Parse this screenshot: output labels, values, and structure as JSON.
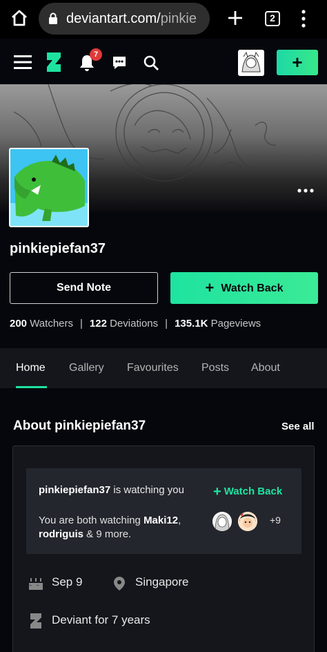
{
  "browser": {
    "url_domain": "deviantart.com/",
    "url_rest": "pinkie",
    "tab_count": "2"
  },
  "header": {
    "notification_count": "7",
    "submit_label": "+"
  },
  "profile": {
    "username": "pinkiepiefan37",
    "send_note_label": "Send Note",
    "watch_back_label": "Watch Back",
    "watch_back_icon": "+",
    "stats": {
      "watchers_count": "200",
      "watchers_label": "Watchers",
      "deviations_count": "122",
      "deviations_label": "Deviations",
      "pageviews_count": "135.1K",
      "pageviews_label": "Pageviews",
      "separator": "|"
    }
  },
  "tabs": [
    {
      "label": "Home",
      "active": true
    },
    {
      "label": "Gallery",
      "active": false
    },
    {
      "label": "Favourites",
      "active": false
    },
    {
      "label": "Posts",
      "active": false
    },
    {
      "label": "About",
      "active": false
    }
  ],
  "about": {
    "title": "About pinkiepiefan37",
    "see_all": "See all",
    "watching_user": "pinkiepiefan37",
    "watching_text": " is watching you",
    "watch_back_label": "Watch Back",
    "watch_back_icon": "+",
    "mutual_prefix": "You are both watching ",
    "mutual_user1": "Maki12",
    "mutual_comma": ",",
    "mutual_user2": "rodriguis",
    "mutual_suffix": " & 9 more.",
    "mutual_more_count": "+9",
    "birthday": "Sep 9",
    "location": "Singapore",
    "deviant_for": "Deviant for 7 years"
  },
  "colors": {
    "accent": "#1ee3a0",
    "background": "#06070d",
    "card": "#14161c",
    "badge": "#e03a3a"
  },
  "icons": [
    "home-icon",
    "lock-icon",
    "new-tab-icon",
    "tab-switcher-icon",
    "menu-kebab-icon",
    "hamburger-menu-icon",
    "deviantart-logo-icon",
    "bell-icon",
    "chat-icon",
    "search-icon",
    "more-options-icon",
    "cake-icon",
    "location-pin-icon",
    "deviantart-small-icon"
  ]
}
